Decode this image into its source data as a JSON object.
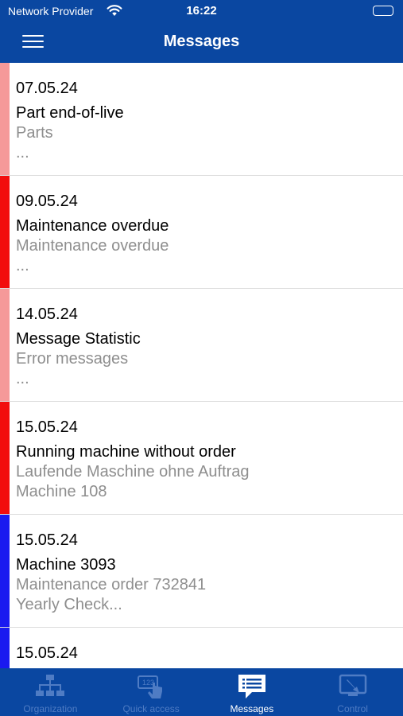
{
  "status_bar": {
    "carrier": "Network Provider",
    "time": "16:22",
    "icons": [
      "wifi-icon",
      "battery-icon"
    ]
  },
  "nav": {
    "title": "Messages",
    "menu_icon": "hamburger-menu-icon"
  },
  "messages": [
    {
      "date": "07.05.24",
      "subject": "Part end-of-live",
      "line1": "Parts",
      "line2": "...",
      "priority_color": "#f59999"
    },
    {
      "date": "09.05.24",
      "subject": "Maintenance overdue",
      "line1": "Maintenance overdue",
      "line2": "...",
      "priority_color": "#f20d0d"
    },
    {
      "date": "14.05.24",
      "subject": "Message Statistic",
      "line1": "Error messages",
      "line2": "...",
      "priority_color": "#f59999"
    },
    {
      "date": "15.05.24",
      "subject": "Running machine without order",
      "line1": "Laufende Maschine ohne Auftrag",
      "line2": "Machine 108",
      "priority_color": "#f20d0d"
    },
    {
      "date": "15.05.24",
      "subject": "Machine 3093",
      "line1": "Maintenance order 732841",
      "line2": "Yearly Check...",
      "priority_color": "#1a1af0"
    },
    {
      "date": "15.05.24",
      "subject": "",
      "line1": "",
      "line2": "",
      "priority_color": "#1a1af0"
    }
  ],
  "tabs": [
    {
      "label": "Organization",
      "icon": "organization-chart-icon",
      "active": false
    },
    {
      "label": "Quick access",
      "icon": "touch-keypad-icon",
      "active": false
    },
    {
      "label": "Messages",
      "icon": "message-list-icon",
      "active": true
    },
    {
      "label": "Control",
      "icon": "monitor-control-icon",
      "active": false
    }
  ],
  "colors": {
    "brand": "#0a47a1",
    "tab_inactive": "#4f7cc4",
    "secondary_text": "#8e8e8e"
  }
}
